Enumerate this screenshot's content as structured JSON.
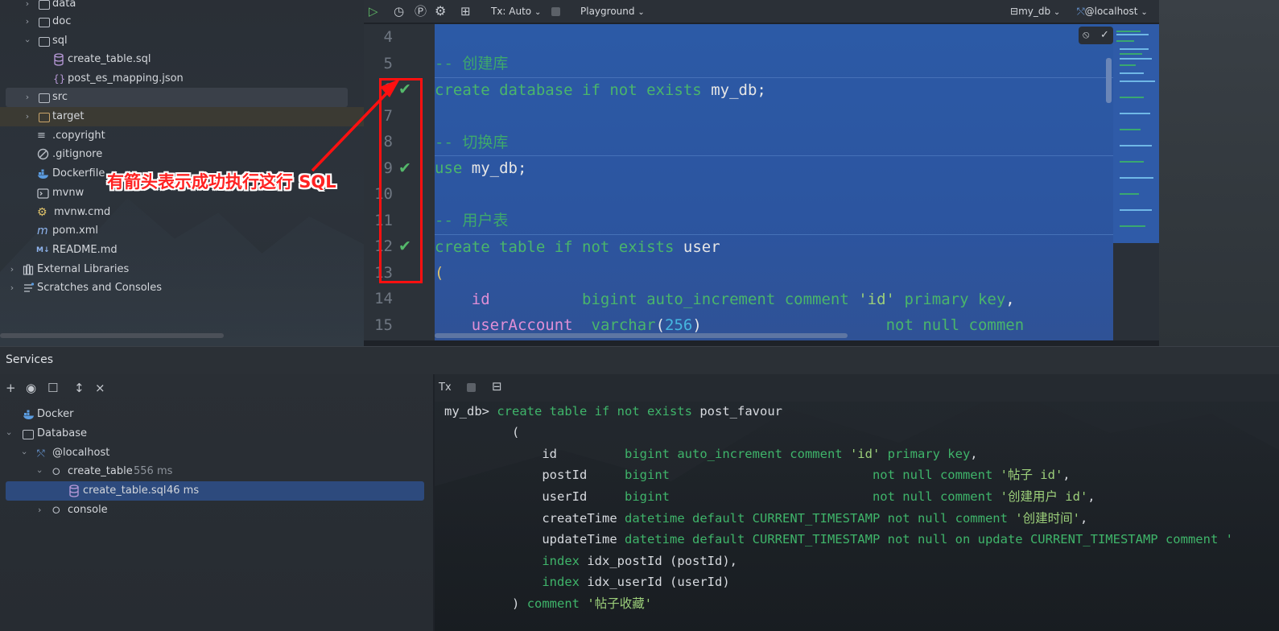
{
  "project_tree": {
    "items": [
      {
        "label": "data",
        "kind": "folder"
      },
      {
        "label": "doc",
        "kind": "folder"
      },
      {
        "label": "sql",
        "kind": "folder"
      },
      {
        "label": "create_table.sql",
        "kind": "sql"
      },
      {
        "label": "post_es_mapping.json",
        "kind": "json"
      },
      {
        "label": "src",
        "kind": "folder"
      },
      {
        "label": "target",
        "kind": "folder"
      },
      {
        "label": ".copyright",
        "kind": "file"
      },
      {
        "label": ".gitignore",
        "kind": "gitignore"
      },
      {
        "label": "Dockerfile",
        "kind": "docker"
      },
      {
        "label": "mvnw",
        "kind": "terminal"
      },
      {
        "label": "mvnw.cmd",
        "kind": "cmd"
      },
      {
        "label": "pom.xml",
        "kind": "maven"
      },
      {
        "label": "README.md",
        "kind": "markdown"
      },
      {
        "label": "External Libraries",
        "kind": "library"
      },
      {
        "label": "Scratches and Consoles",
        "kind": "scratch"
      }
    ]
  },
  "editor": {
    "toolbar": {
      "tx_mode": "Tx: Auto",
      "playground": "Playground",
      "schema": "my_db",
      "datasource": "@localhost"
    },
    "line_numbers": [
      "4",
      "5",
      "6",
      "7",
      "8",
      "9",
      "10",
      "11",
      "12",
      "13",
      "14",
      "15"
    ],
    "code": {
      "l5": "-- 创建库",
      "l6_kw": "create database if not exists",
      "l6_id": "my_db;",
      "l8": "-- 切换库",
      "l9_kw": "use",
      "l9_id": "my_db;",
      "l11": "-- 用户表",
      "l12_kw": "create table if not exists",
      "l12_id": "user",
      "l13": "(",
      "l14_col": "id",
      "l14_type": "bigint auto_increment comment",
      "l14_str": "'id'",
      "l14_tail": "primary key",
      "l14_comma": ",",
      "l15_col": "userAccount",
      "l15_type": "varchar",
      "l15_paren_open": "(",
      "l15_num": "256",
      "l15_paren_close": ")",
      "l15_tail": "not null commen"
    }
  },
  "annotation": {
    "text": "有箭头表示成功执行这行 SQL"
  },
  "services": {
    "title": "Services",
    "tree": {
      "docker": "Docker",
      "database": "Database",
      "localhost": "@localhost",
      "create_table": "create_table",
      "create_table_time": "556 ms",
      "create_table_sql": "create_table.sql",
      "create_table_sql_time": "46 ms",
      "console": "console"
    },
    "console": {
      "tx_label": "Tx",
      "lines": {
        "prompt": "my_db>",
        "c1_kw": "create table if not exists",
        "c1_id": "post_favour",
        "c2": "(",
        "c3_col": "id",
        "c3_type": "bigint auto_increment comment",
        "c3_str": "'id'",
        "c3_tail": "primary key",
        "c3_punct": ",",
        "c4_col": "postId",
        "c4_type": "bigint",
        "c4_tail": "not null comment",
        "c4_str": "'帖子 id'",
        "c4_punct": ",",
        "c5_col": "userId",
        "c5_type": "bigint",
        "c5_tail": "not null comment",
        "c5_str": "'创建用户 id'",
        "c5_punct": ",",
        "c6_col": "createTime",
        "c6_type": "datetime default",
        "c6_const": "CURRENT_TIMESTAMP",
        "c6_tail": "not null comment",
        "c6_str": "'创建时间'",
        "c6_punct": ",",
        "c7_col": "updateTime",
        "c7_type": "datetime default",
        "c7_const": "CURRENT_TIMESTAMP",
        "c7_mid": "not null on update",
        "c7_const2": "CURRENT_TIMESTAMP",
        "c7_tail": "comment '",
        "c8_kw": "index",
        "c8_rest": "idx_postId (postId),",
        "c9_kw": "index",
        "c9_rest": "idx_userId (userId)",
        "c10_paren": ")",
        "c10_kw": "comment",
        "c10_str": "'帖子收藏'"
      }
    }
  },
  "colors": {
    "editor_selection": "#2c5aa6",
    "success_check": "#54b86a",
    "annotation_red": "#ff1010",
    "keyword_green": "#4ab56b"
  }
}
